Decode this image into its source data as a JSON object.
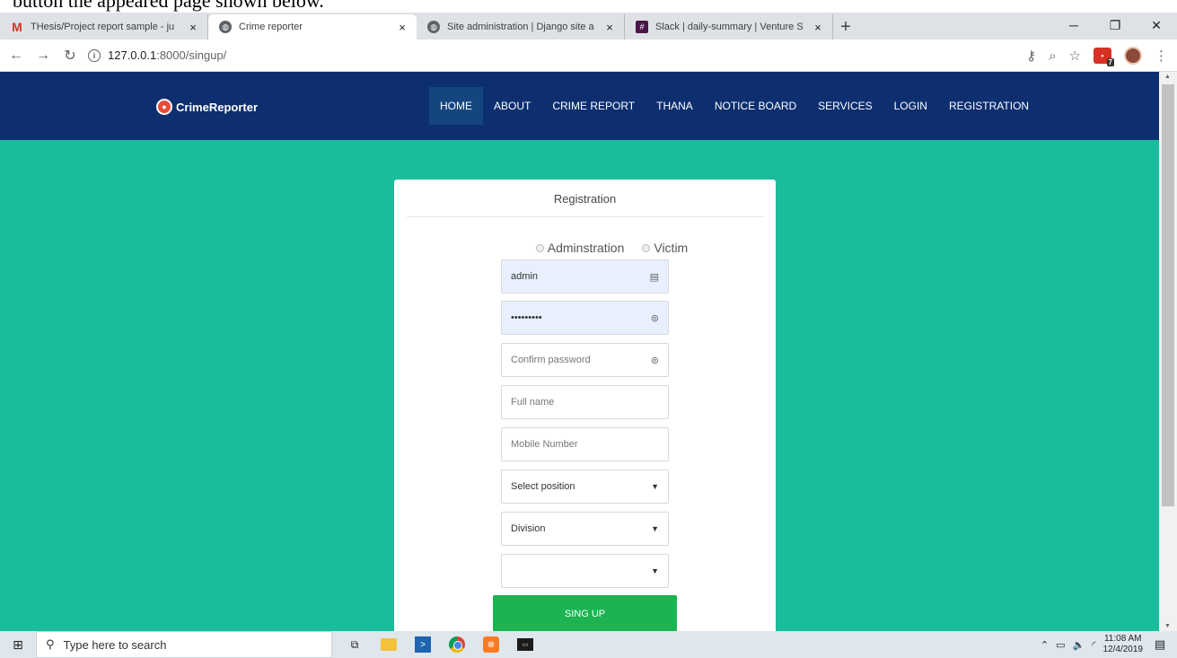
{
  "doc_caption": "button the appeared page shown below.",
  "browser": {
    "tabs": [
      {
        "title": "THesis/Project report sample - ju",
        "icon": "gmail-icon",
        "active": false
      },
      {
        "title": "Crime reporter",
        "icon": "globe-icon",
        "active": true
      },
      {
        "title": "Site administration | Django site a",
        "icon": "globe-icon",
        "active": false
      },
      {
        "title": "Slack | daily-summary | Venture S",
        "icon": "slack-icon",
        "active": false
      }
    ],
    "close_glyph": "×",
    "new_tab_glyph": "+",
    "url_host": "127.0.0.1",
    "url_rest": ":8000/singup/",
    "ext_badge": "7"
  },
  "site": {
    "logo_text": "CrimeReporter",
    "menu": [
      "HOME",
      "ABOUT",
      "CRIME REPORT",
      "THANA",
      "NOTICE BOARD",
      "SERVICES",
      "LOGIN",
      "REGISTRATION"
    ],
    "active_menu": "HOME"
  },
  "form": {
    "title": "Registration",
    "radio_admin": "Adminstration",
    "radio_victim": "Victim",
    "username_value": "admin",
    "password_value": "•••••••••",
    "confirm_placeholder": "Confirm password",
    "fullname_placeholder": "Full name",
    "mobile_placeholder": "Mobile Number",
    "position_selected": "Select position",
    "division_selected": "Division",
    "district_selected": "",
    "submit_label": "SING UP"
  },
  "taskbar": {
    "search_placeholder": "Type here to search",
    "time": "11:08 AM",
    "date": "12/4/2019"
  },
  "colors": {
    "navbar": "#0d2f70",
    "page_bg": "#1abc9c",
    "button": "#1cb350"
  }
}
